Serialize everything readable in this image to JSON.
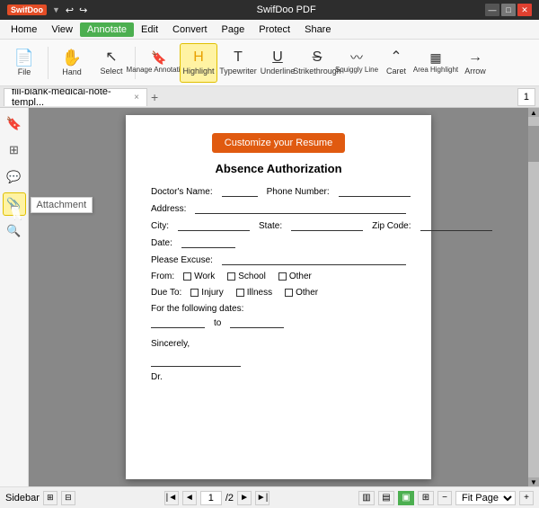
{
  "titlebar": {
    "logo": "SwifDoo",
    "title": "SwifDoo PDF",
    "buttons": [
      "—",
      "□",
      "✕"
    ]
  },
  "menubar": {
    "items": [
      "Home",
      "View",
      "Annotate",
      "Edit",
      "Convert",
      "Page",
      "Protect",
      "Share"
    ]
  },
  "toolbar": {
    "tools": [
      {
        "id": "file",
        "icon": "📄",
        "label": "File"
      },
      {
        "id": "hand",
        "icon": "✋",
        "label": "Hand"
      },
      {
        "id": "select",
        "icon": "↖",
        "label": "Select"
      },
      {
        "id": "manage",
        "icon": "🔖",
        "label": "Manage Annotations"
      },
      {
        "id": "highlight",
        "icon": "Hl",
        "label": "Highlight"
      },
      {
        "id": "typewriter",
        "icon": "T",
        "label": "Typewriter"
      },
      {
        "id": "underline",
        "icon": "U̲",
        "label": "Underline"
      },
      {
        "id": "strikethrough",
        "icon": "S̶",
        "label": "Strikethrough"
      },
      {
        "id": "squiggly",
        "icon": "~",
        "label": "Squiggly Line"
      },
      {
        "id": "caret",
        "icon": "^",
        "label": "Caret"
      },
      {
        "id": "area-highlight",
        "icon": "▨",
        "label": "Area Highlight"
      },
      {
        "id": "arrow",
        "icon": "→",
        "label": "Arrow"
      }
    ],
    "active_tool": "highlight"
  },
  "tab": {
    "filename": "fill-blank-medical-note-templ...",
    "close": "×",
    "add": "+"
  },
  "sidebar": {
    "icons": [
      {
        "id": "bookmark",
        "symbol": "🔖",
        "tooltip": ""
      },
      {
        "id": "pages",
        "symbol": "⊞",
        "tooltip": ""
      },
      {
        "id": "comment",
        "symbol": "💬",
        "tooltip": ""
      },
      {
        "id": "attachment",
        "symbol": "📎",
        "tooltip": "Attachment"
      },
      {
        "id": "search",
        "symbol": "🔍",
        "tooltip": ""
      }
    ],
    "active": "attachment"
  },
  "document": {
    "customize_btn": "Customize your Resume",
    "title": "Absence Authorization",
    "fields": {
      "doctors_name": "Doctor's Name:",
      "phone_number": "Phone Number:",
      "address": "Address:",
      "city": "City:",
      "state": "State:",
      "zip_code": "Zip Code:",
      "date": "Date:",
      "please_excuse": "Please Excuse:",
      "from_label": "From:",
      "due_to_label": "Due To:",
      "work": "Work",
      "school": "School",
      "other1": "Other",
      "injury": "Injury",
      "illness": "Illness",
      "other2": "Other",
      "for_following_dates": "For the following dates:",
      "to": "to",
      "sincerely": "Sincerely,",
      "dr": "Dr."
    }
  },
  "statusbar": {
    "sidebar_label": "Sidebar",
    "page_current": "1",
    "page_total": "/2",
    "fit_label": "Fit Page",
    "page_number_display": "1"
  }
}
